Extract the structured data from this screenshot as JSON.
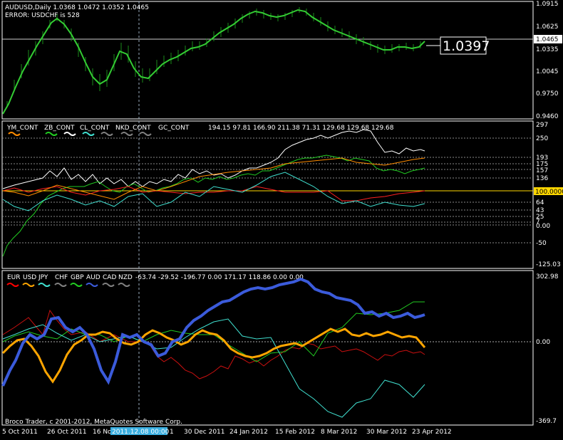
{
  "panes": {
    "main": {
      "title_line": "AUDUSD,Daily  1.0368 1.0472 1.0352 1.0465",
      "error_line": "ERROR: USDCHF is 528",
      "price_tag": "1.0397",
      "current_price_label": "1.0465",
      "y_tick_labels": [
        "1.0915",
        "1.0625",
        "1.0335",
        "1.0045",
        "0.9750",
        "0.9460"
      ],
      "colors": {
        "price_line": "#33cc33",
        "bars": "#1a8a1a",
        "grid": "#ffffff"
      }
    },
    "indicator1": {
      "legend": [
        {
          "label": "YM_CONT",
          "color": "#ff8c00"
        },
        {
          "label": "ZB_CONT",
          "color": "#22cc22"
        },
        {
          "label": "CL_CONT",
          "color": "#ffffff"
        },
        {
          "label": "NKD_CONT",
          "color": "#40e0d0"
        },
        {
          "label": "GC_CONT",
          "color": "#808080"
        },
        {
          "label": "",
          "color": "#808080"
        }
      ],
      "values_text": "194.15 97.81 166.90 211.38 71.31 129.68 129.68 129.68",
      "y_tick_labels": [
        "297",
        "250",
        "193",
        "175",
        "157",
        "136",
        "64",
        "43",
        "25",
        "7",
        "0.00",
        "-50",
        "-125.03"
      ],
      "highlight_label": "100.0000",
      "highlight_color": "#ffd700"
    },
    "indicator2": {
      "legend": [
        {
          "label": "EUR",
          "color": "#ff0000"
        },
        {
          "label": "USD",
          "color": "#ffa500"
        },
        {
          "label": "JPY",
          "color": "#40e0d0"
        },
        {
          "label": "CHF",
          "color": "#808080"
        },
        {
          "label": "GBP",
          "color": "#22cc22"
        },
        {
          "label": "AUD",
          "color": "#3b5bdb"
        },
        {
          "label": "CAD",
          "color": "#808080"
        },
        {
          "label": "NZD",
          "color": "#808080"
        }
      ],
      "values_text": "-63.74 -29.52 -196.77 0.00 171.17 118.86 0.00 0.00",
      "y_tick_labels": [
        "302.98",
        "0.00",
        "-369.7"
      ]
    }
  },
  "x_axis": {
    "dates": [
      "5 Oct 2011",
      "26 Oct 2011",
      "16 No",
      "1",
      "30 Dec 2011",
      "24 Jan 2012",
      "15 Feb 2012",
      "8 Mar 2012",
      "30 Mar 2012",
      "23 Apr 2012"
    ],
    "crosshair_label": "2011.12.08 00:00"
  },
  "footer": {
    "copyright": "Broco Trader, c 2001-2012, MetaQuotes Software Corp."
  }
}
